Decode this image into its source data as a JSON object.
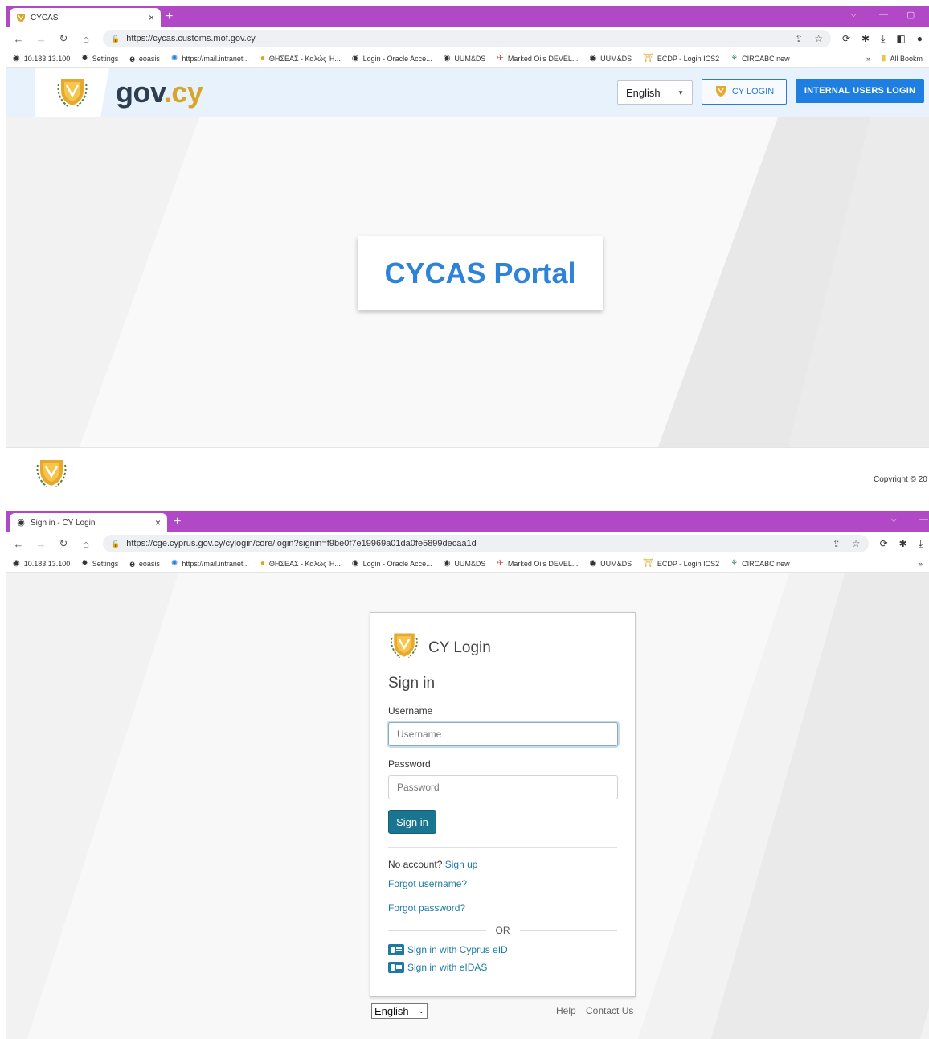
{
  "window1": {
    "tab": {
      "title": "CYCAS",
      "close": "×",
      "new_tab": "+"
    },
    "address": {
      "url": "https://cycas.customs.mof.gov.cy"
    },
    "bookmarks": [
      "10.183.13.100",
      "Settings",
      "eoasis",
      "https://mail.intranet...",
      "ΘΗΣΕΑΣ - Καλώς Ή...",
      "Login - Oracle Acce...",
      "UUM&DS",
      "Marked Oils DEVEL...",
      "UUM&DS",
      "ECDP - Login ICS2",
      "CIRCABC new"
    ],
    "bookmarks_more": "»",
    "bookmarks_all": "All Bookm",
    "header": {
      "brand_gov": "gov",
      "brand_cy": ".cy",
      "language": "English",
      "cy_login_label": "CY LOGIN",
      "internal_login_label": "INTERNAL USERS LOGIN"
    },
    "hero": {
      "portal_title": "CYCAS Portal"
    },
    "footer": {
      "copyright": "Copyright © 20"
    }
  },
  "window2": {
    "tab": {
      "title": "Sign in - CY Login",
      "close": "×",
      "new_tab": "+"
    },
    "address": {
      "url": "https://cge.cyprus.gov.cy/cylogin/core/login?signin=f9be0f7e19969a01da0fe5899decaa1d"
    },
    "bookmarks": [
      "10.183.13.100",
      "Settings",
      "eoasis",
      "https://mail.intranet...",
      "ΘΗΣΕΑΣ - Καλώς Ή...",
      "Login - Oracle Acce...",
      "UUM&DS",
      "Marked Oils DEVEL...",
      "UUM&DS",
      "ECDP - Login ICS2",
      "CIRCABC new"
    ],
    "bookmarks_more": "»",
    "login": {
      "brand": "CY Login",
      "heading": "Sign in",
      "username_label": "Username",
      "username_placeholder": "Username",
      "password_label": "Password",
      "password_placeholder": "Password",
      "signin_button": "Sign in",
      "no_account": "No account?",
      "signup_link": "Sign up",
      "forgot_username": "Forgot username?",
      "forgot_password": "Forgot password?",
      "or": "OR",
      "eid_link": "Sign in with Cyprus eID",
      "eidas_link": "Sign in with eIDAS"
    },
    "footer": {
      "language": "English",
      "help": "Help",
      "contact": "Contact Us"
    }
  },
  "colors": {
    "tabbar": "#b148c6",
    "gov_blue": "#2c83d8",
    "internal_button": "#1e7fe0",
    "cy_gold": "#d7a529",
    "signin_button": "#1a7690",
    "link": "#1d7ba3"
  }
}
